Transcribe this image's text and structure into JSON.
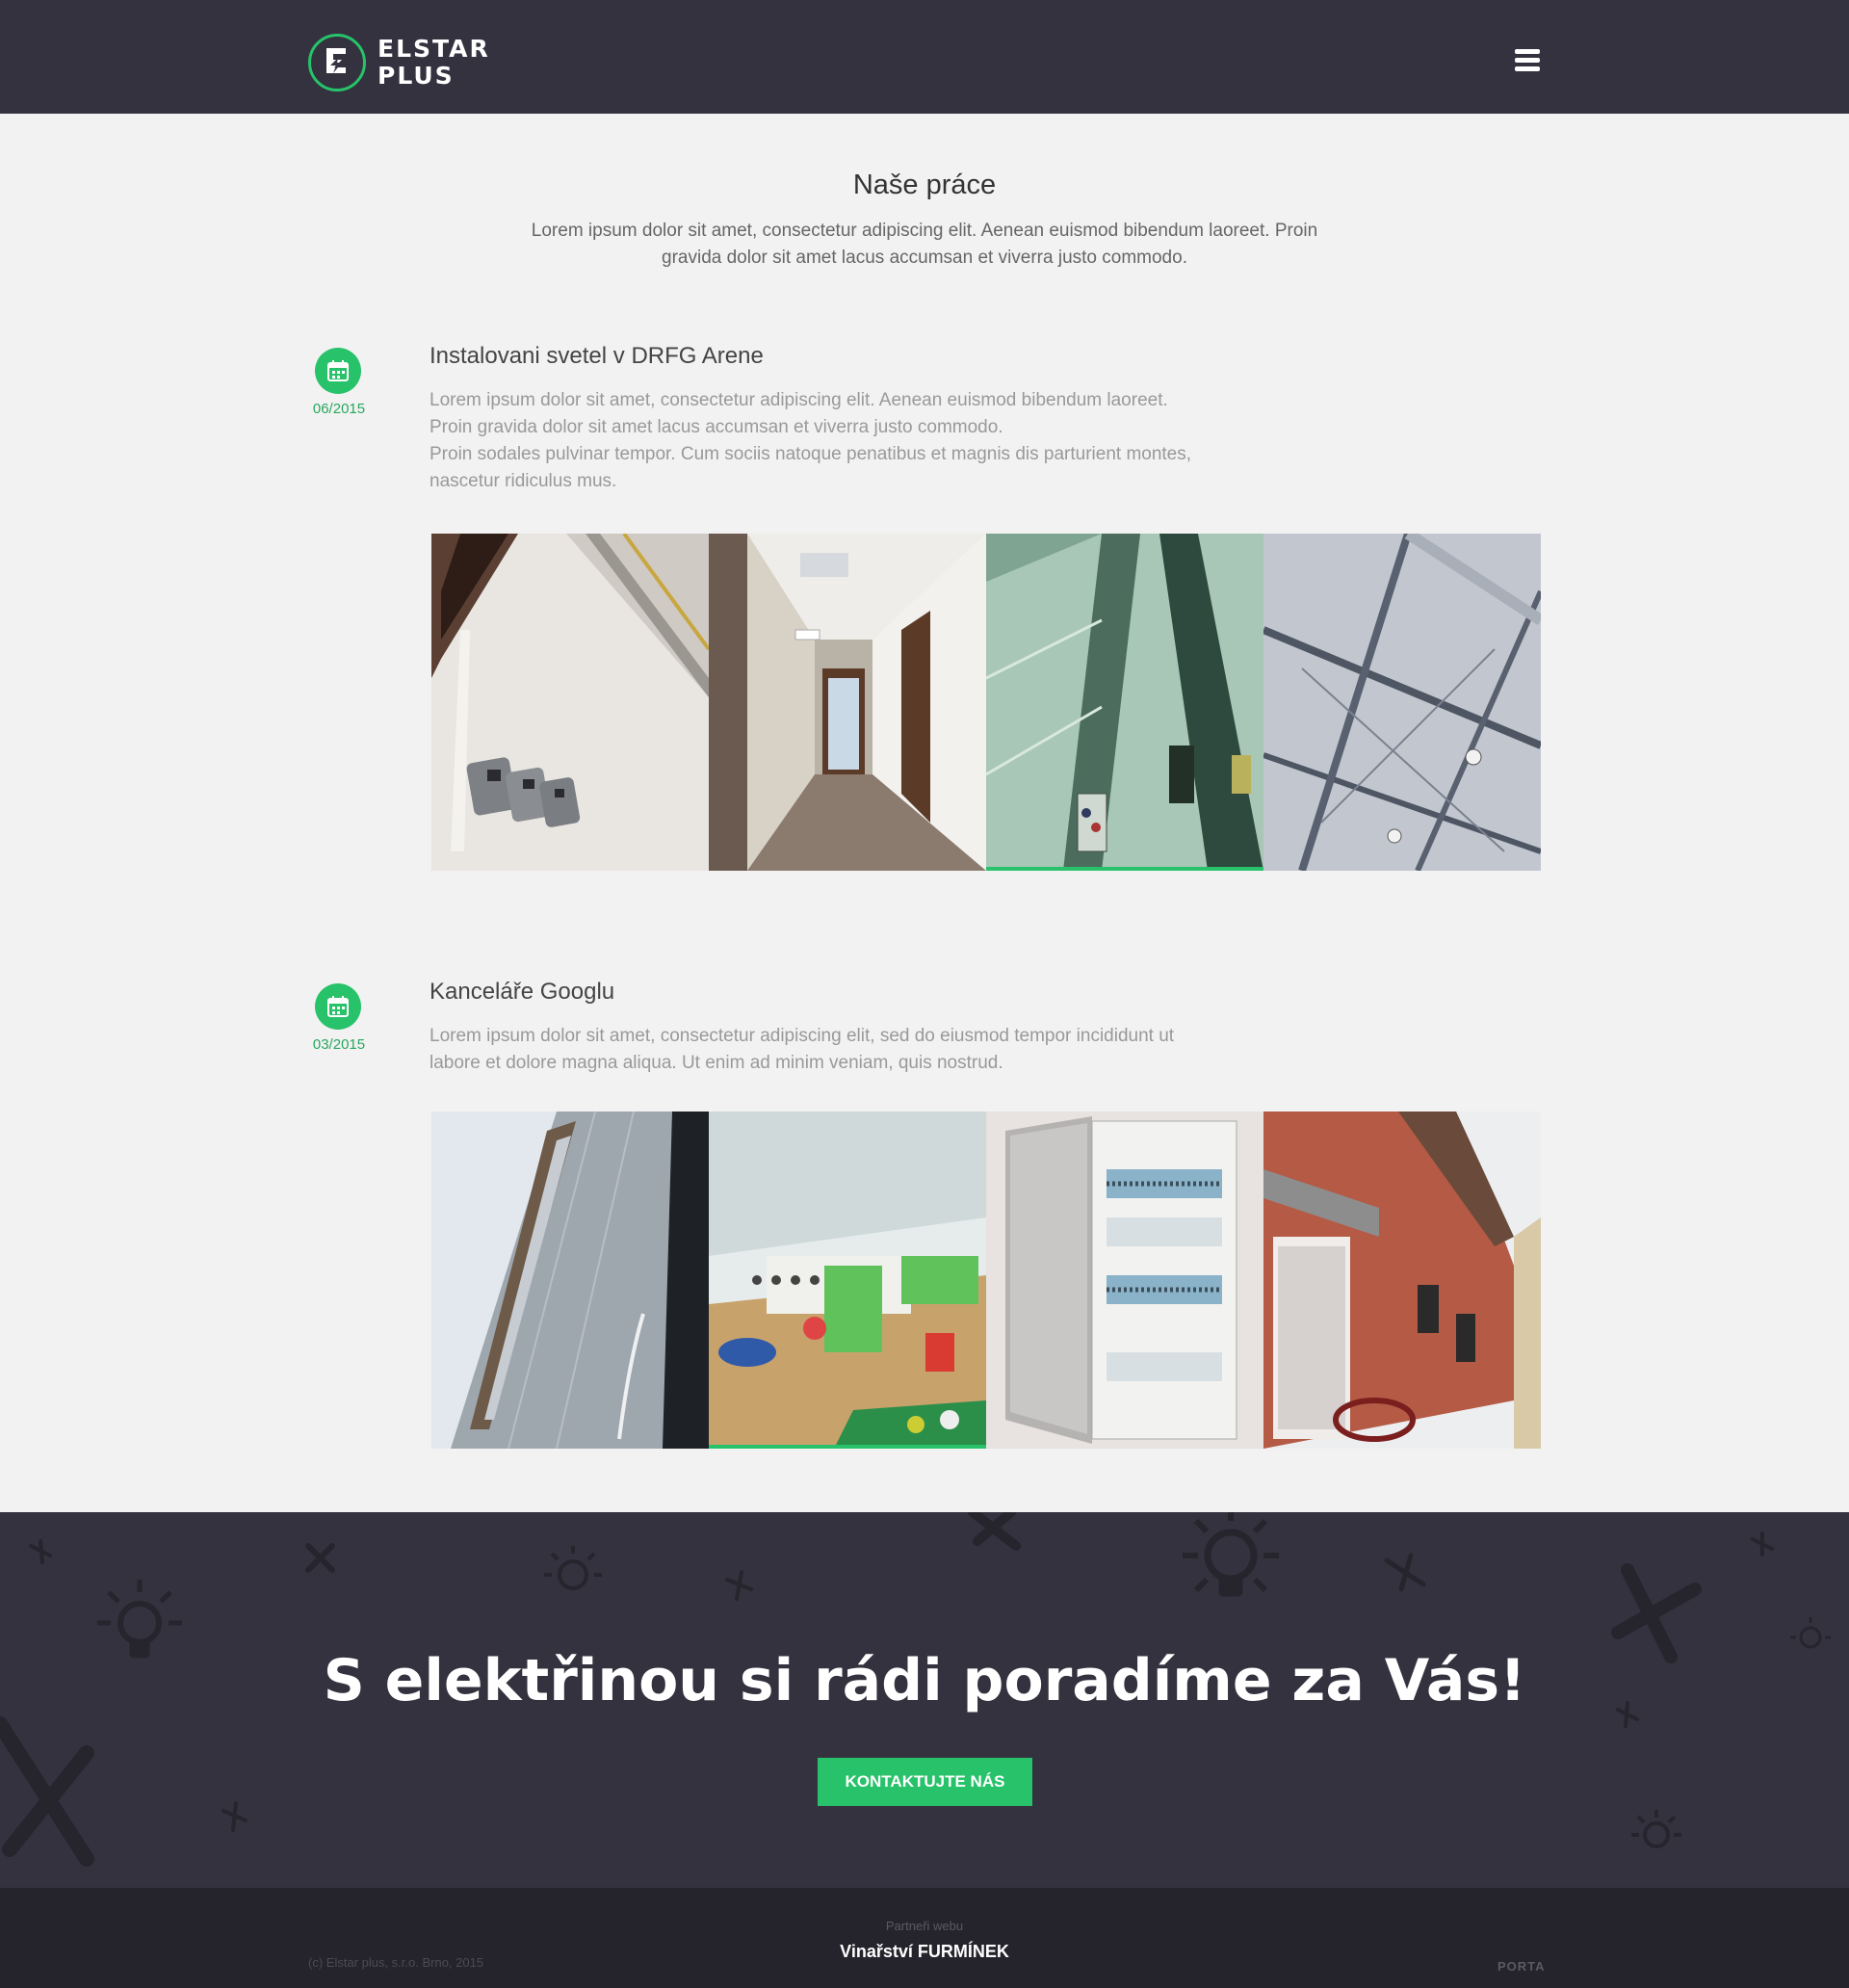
{
  "header": {
    "logo_line1": "ELSTAR",
    "logo_line2": "PLUS"
  },
  "intro": {
    "title": "Naše práce",
    "text": "Lorem ipsum dolor sit amet, consectetur adipiscing elit. Aenean euismod bibendum laoreet. Proin gravida dolor sit amet lacus accumsan et viverra justo commodo."
  },
  "projects": [
    {
      "date": "06/2015",
      "title": "Instalovani svetel v DRFG Arene",
      "description_lines": [
        "Lorem ipsum dolor sit amet, consectetur adipiscing elit. Aenean euismod bibendum laoreet.",
        "Proin gravida dolor sit amet lacus accumsan et viverra justo commodo.",
        "Proin sodales pulvinar tempor. Cum sociis natoque penatibus et magnis dis parturient montes,",
        "nascetur ridiculus mus."
      ],
      "photos": [
        "wall-socket-photo",
        "hallway-photo",
        "green-wall-panel-photo",
        "roof-structure-photo"
      ],
      "active_photo": 2
    },
    {
      "date": "03/2015",
      "title": "Kanceláře Googlu",
      "description_lines": [
        "Lorem ipsum dolor sit amet, consectetur adipiscing elit, sed do eiusmod tempor incididunt ut",
        "labore et dolore magna aliqua. Ut enim ad minim veniam, quis nostrud."
      ],
      "photos": [
        "facade-photo",
        "office-interior-photo",
        "switchboard-photo",
        "brick-house-photo"
      ],
      "active_photo": 1
    }
  ],
  "cta": {
    "heading": "S elektřinou si rádi poradíme za Vás!",
    "button": "KONTAKTUJTE NÁS"
  },
  "footer": {
    "copyright": "(c) Elstar plus, s.r.o. Brno, 2015",
    "partners_label": "Partneři webu",
    "partner": "Vinařství FURMÍNEK",
    "porta": "PORTA"
  },
  "colors": {
    "accent": "#27c26a",
    "header_bg": "#33323e",
    "footer_bg": "#25242c",
    "page_bg": "#f2f2f2"
  }
}
